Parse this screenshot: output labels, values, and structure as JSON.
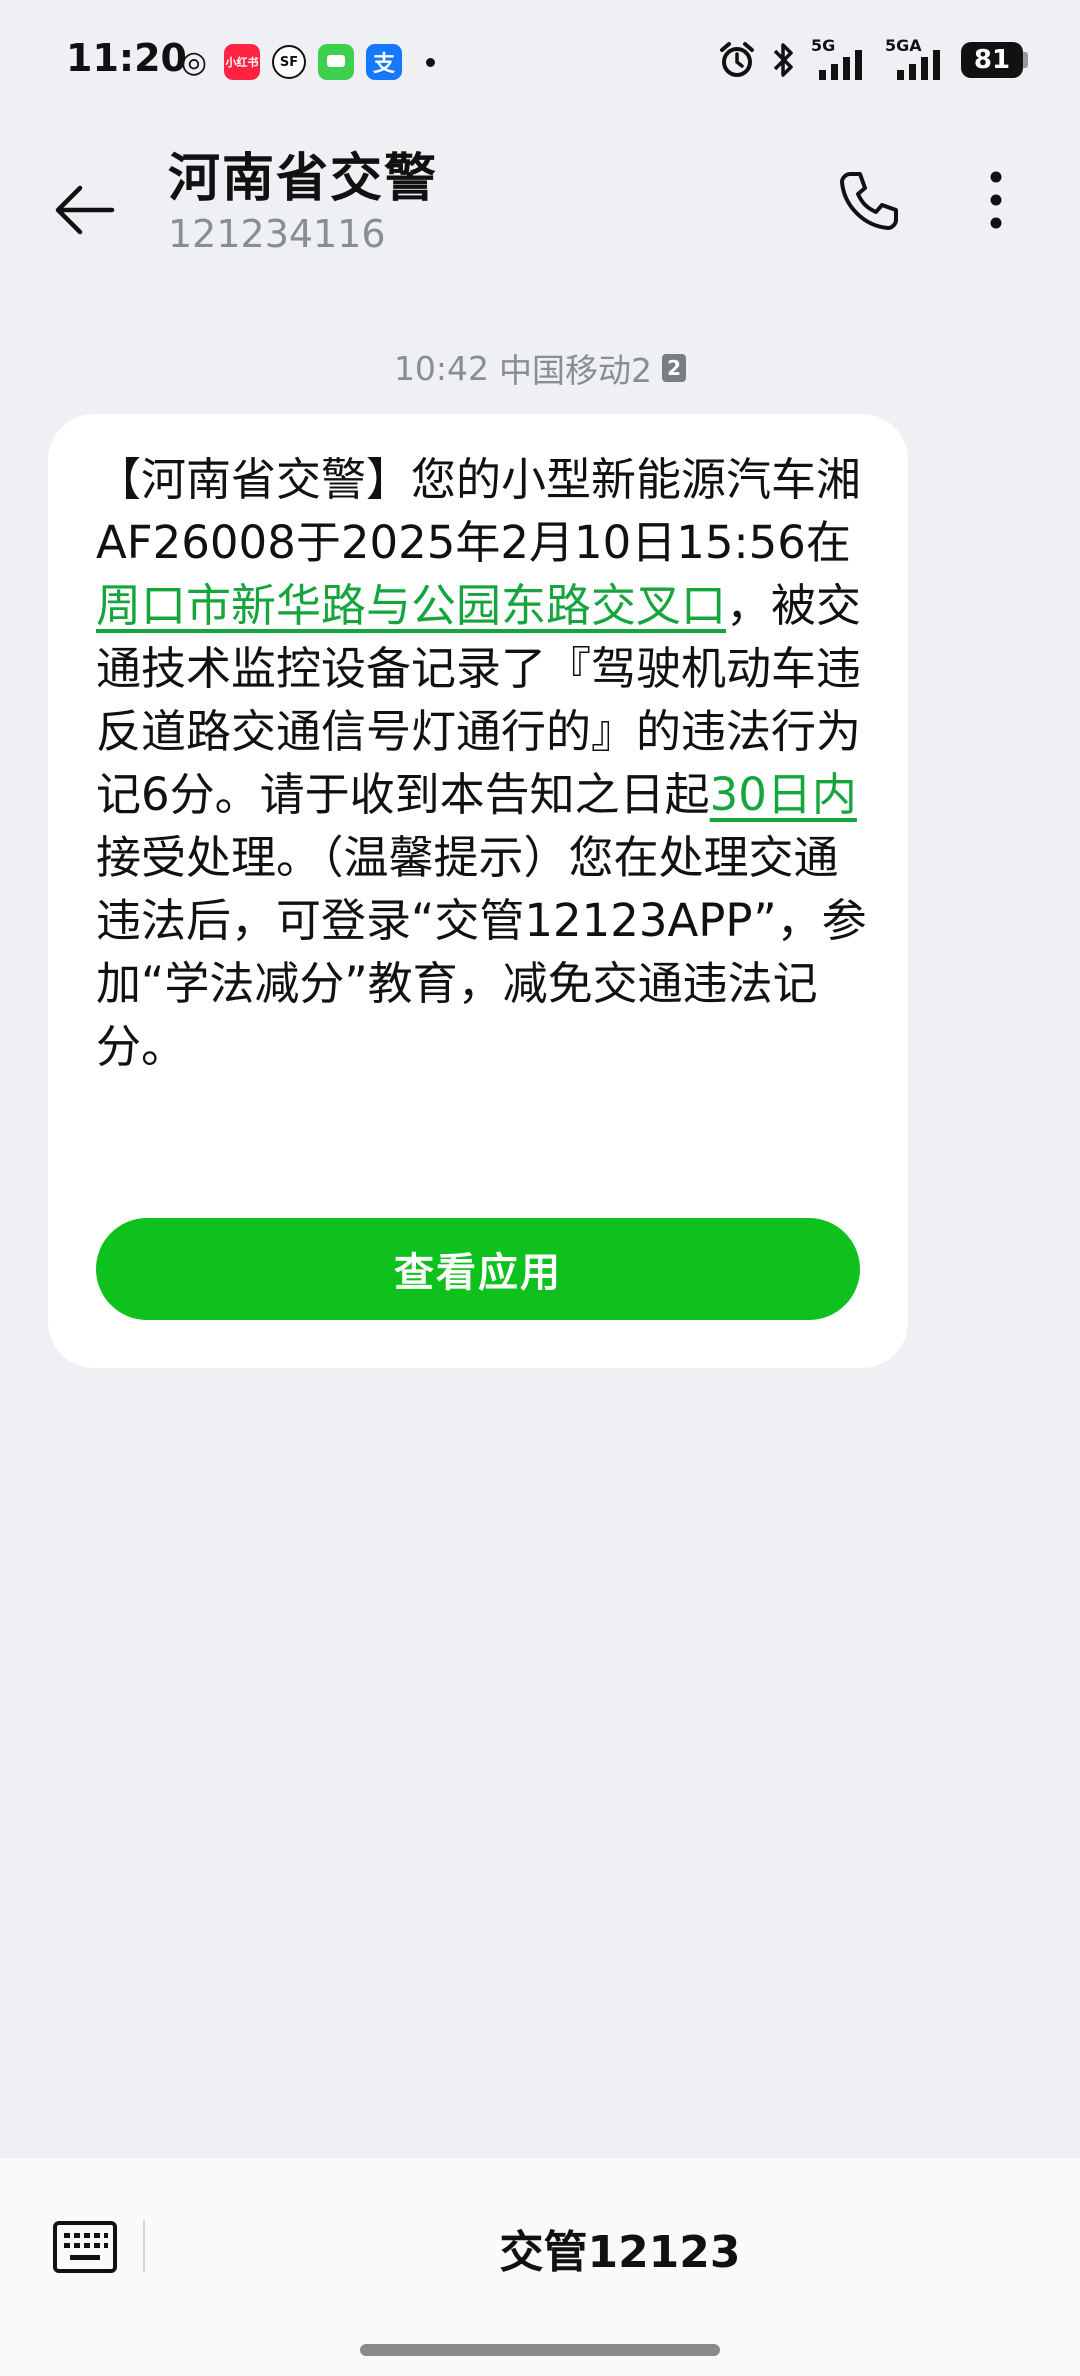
{
  "status_bar": {
    "time": "11:20",
    "apps": [
      {
        "icon": "wechat-icon",
        "glyph": "◎",
        "color": "#111111"
      },
      {
        "icon": "xiaohongshu-icon",
        "glyph": "小红书",
        "color": "#ff2442"
      },
      {
        "icon": "sf-express-icon",
        "glyph": "SF",
        "color": "#111111"
      },
      {
        "icon": "messages-icon",
        "glyph": "▭",
        "color": "#3fcf4f"
      },
      {
        "icon": "alipay-icon",
        "glyph": "支",
        "color": "#1677ff"
      }
    ],
    "network1": "5G",
    "network2": "5GA",
    "battery": "81"
  },
  "header": {
    "title": "河南省交警",
    "number": "121234116"
  },
  "timestamp": {
    "time": "10:42",
    "carrier": "中国移动2",
    "sim": "2"
  },
  "message": {
    "part1": "【河南省交警】您的小型新能源汽车湘AF26008于2025年2月10日15:56在",
    "link_location": "周口市新华路与公园东路交叉口",
    "part2": "，被交通技术监控设备记录了『驾驶机动车违反道路交通信号灯通行的』的违法行为记6分。请于收到本告知之日起",
    "link_deadline": "30日内",
    "part3": "接受处理。（温馨提示）您在处理交通违法后，可登录“交管12123APP”，参加“学法减分”教育，减免交通违法记分。",
    "button": "查看应用"
  },
  "bottom_bar": {
    "menu_label": "交管12123"
  },
  "colors": {
    "accent_green": "#0ec11c",
    "link_green": "#16a53d",
    "background": "#eef0f3"
  }
}
